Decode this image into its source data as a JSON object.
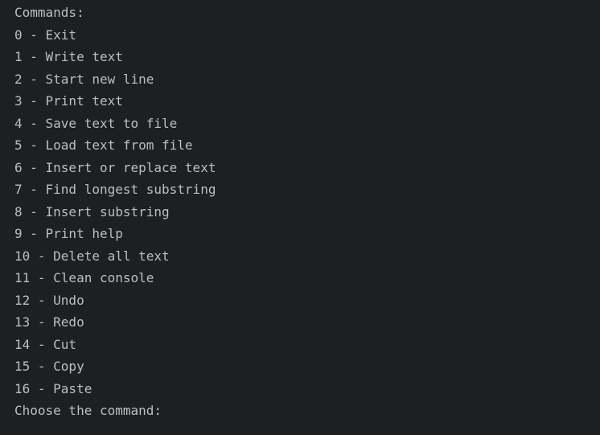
{
  "console": {
    "header": "Commands:",
    "commands": [
      "0 - Exit",
      "1 - Write text",
      "2 - Start new line",
      "3 - Print text",
      "4 - Save text to file",
      "5 - Load text from file",
      "6 - Insert or replace text",
      "7 - Find longest substring",
      "8 - Insert substring",
      "9 - Print help",
      "10 - Delete all text",
      "11 - Clean console",
      "12 - Undo",
      "13 - Redo",
      "14 - Cut",
      "15 - Copy",
      "16 - Paste"
    ],
    "prompt": "Choose the command:"
  }
}
